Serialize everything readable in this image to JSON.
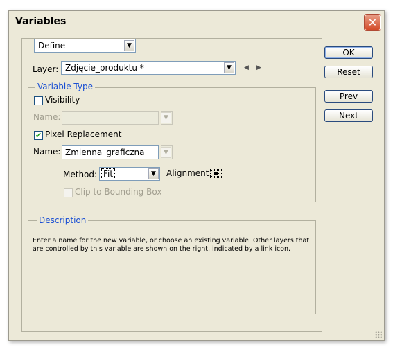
{
  "window": {
    "title": "Variables",
    "close_symbol": "✕"
  },
  "define_select": {
    "value": "Define"
  },
  "layer": {
    "label": "Layer:",
    "value": "Zdjęcie_produktu *"
  },
  "variable_type": {
    "legend": "Variable Type",
    "visibility": {
      "label": "Visibility",
      "checked": false
    },
    "visibility_name": {
      "label": "Name:",
      "value": ""
    },
    "pixel_replacement": {
      "label": "Pixel Replacement",
      "checked": true
    },
    "pixel_name": {
      "label": "Name:",
      "value": "Zmienna_graficzna"
    },
    "method": {
      "label": "Method:",
      "value": "Fit"
    },
    "alignment": {
      "label": "Alignment:"
    },
    "clip": {
      "label": "Clip to Bounding Box",
      "checked": false
    }
  },
  "description": {
    "legend": "Description",
    "text": "Enter a name for the new variable, or choose an existing variable. Other layers that are controlled by this variable are shown on the right, indicated by a link icon."
  },
  "buttons": {
    "ok": "OK",
    "reset": "Reset",
    "prev": "Prev",
    "next": "Next"
  },
  "icons": {
    "dropdown": "chevron-down-icon",
    "prev_layer": "triangle-left-icon",
    "next_layer": "triangle-right-icon",
    "checkmark": "checkmark-icon",
    "alignment": "alignment-grid-icon",
    "resize": "resize-grip-icon"
  },
  "colors": {
    "legend_text": "#1a4fd3",
    "dialog_bg": "#ece9d8",
    "checkmark": "#21a121"
  }
}
